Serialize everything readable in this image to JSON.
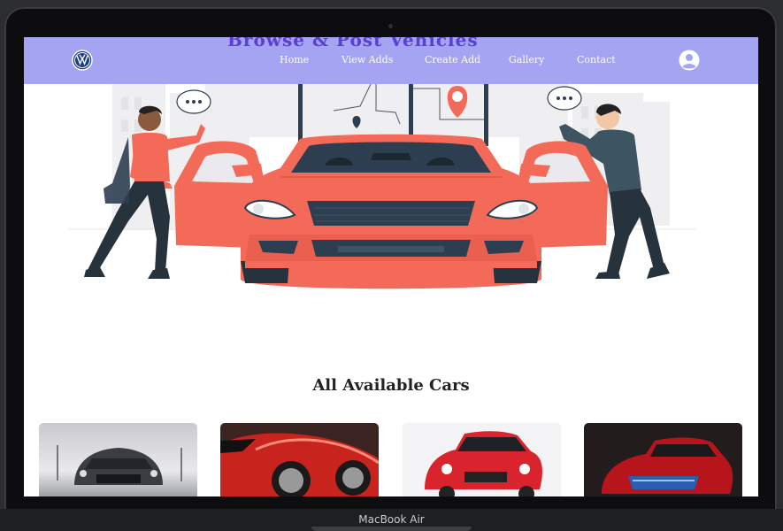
{
  "nav": {
    "links": [
      "Home",
      "View Adds",
      "Create Add",
      "Gallery",
      "Contact"
    ]
  },
  "hero": {
    "partial_title": "Browse & Post Vehicles"
  },
  "section": {
    "title": "All Available Cars"
  },
  "cards": [
    {
      "alt": "grey mustang"
    },
    {
      "alt": "red sports car"
    },
    {
      "alt": "red suzuki swift"
    },
    {
      "alt": "red concept car"
    }
  ],
  "device": {
    "label": "MacBook Air"
  },
  "colors": {
    "nav": "#a4a4f2",
    "car": "#f46a58",
    "accent": "#ff6f5e"
  }
}
